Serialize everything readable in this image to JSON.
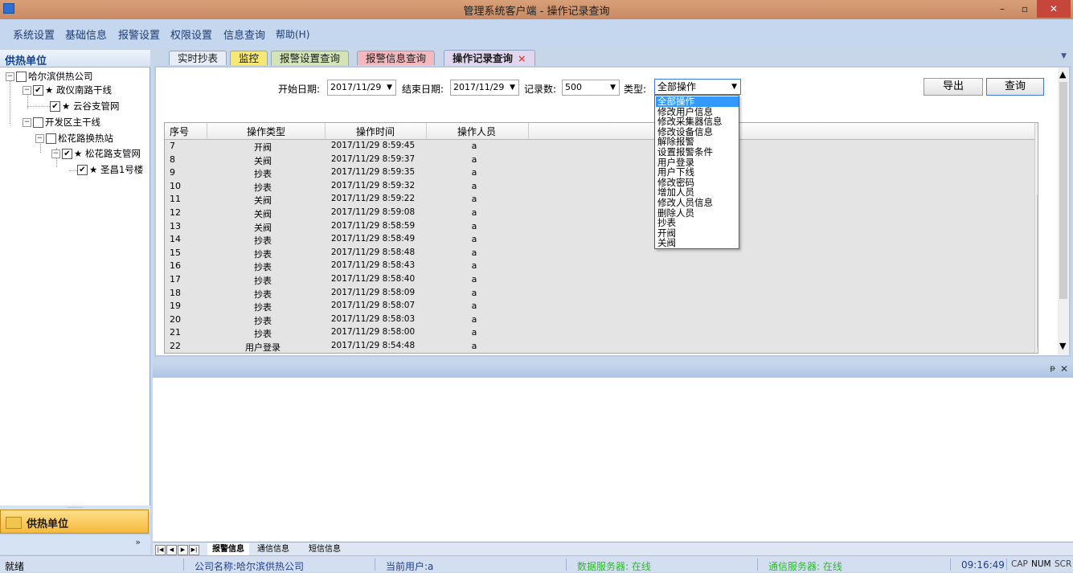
{
  "window": {
    "title": "管理系统客户端 - 操作记录查询",
    "min": "–",
    "max": "▫",
    "close": "✕"
  },
  "menu": [
    {
      "label": "系统设置"
    },
    {
      "label": "基础信息"
    },
    {
      "label": "报警设置"
    },
    {
      "label": "权限设置"
    },
    {
      "label": "信息查询"
    },
    {
      "label": "帮助(H)"
    }
  ],
  "left_panel": {
    "header": "供热单位",
    "tree": [
      {
        "label": "哈尔滨供热公司",
        "checked": false,
        "star": false
      },
      {
        "label": "政仪南路干线",
        "checked": true,
        "star": true
      },
      {
        "label": "云谷支管网",
        "checked": true,
        "star": true
      },
      {
        "label": "开发区主干线",
        "checked": false,
        "star": false
      },
      {
        "label": "松花路换热站",
        "checked": false,
        "star": false
      },
      {
        "label": "松花路支管网",
        "checked": true,
        "star": true
      },
      {
        "label": "圣昌1号楼",
        "checked": true,
        "star": true
      }
    ],
    "bottom_button": "供热单位",
    "chevron": "»",
    "grip": "··········"
  },
  "tabs": [
    {
      "label": "实时抄表",
      "color": "#e6edf7"
    },
    {
      "label": "监控",
      "color": "#f7e873"
    },
    {
      "label": "报警设置查询",
      "color": "#d4e4b8"
    },
    {
      "label": "报警信息查询",
      "color": "#f3b9bf"
    },
    {
      "label": "操作记录查询",
      "color": "#e0d6ee",
      "active": true
    }
  ],
  "tab_close": "×",
  "tab_scroll": "▼",
  "filters": {
    "start_label": "开始日期:",
    "start_value": "2017/11/29",
    "end_label": "结束日期:",
    "end_value": "2017/11/29",
    "count_label": "记录数:",
    "count_value": "500",
    "type_label": "类型:",
    "type_value": "全部操作"
  },
  "buttons": {
    "export": "导出",
    "query": "查询"
  },
  "grid": {
    "columns": [
      "序号",
      "操作类型",
      "操作时间",
      "操作人员"
    ],
    "rows": [
      [
        "7",
        "开阀",
        "2017/11/29 8:59:45",
        "a"
      ],
      [
        "8",
        "关阀",
        "2017/11/29 8:59:37",
        "a"
      ],
      [
        "9",
        "抄表",
        "2017/11/29 8:59:35",
        "a"
      ],
      [
        "10",
        "抄表",
        "2017/11/29 8:59:32",
        "a"
      ],
      [
        "11",
        "关阀",
        "2017/11/29 8:59:22",
        "a"
      ],
      [
        "12",
        "关阀",
        "2017/11/29 8:59:08",
        "a"
      ],
      [
        "13",
        "关阀",
        "2017/11/29 8:58:59",
        "a"
      ],
      [
        "14",
        "抄表",
        "2017/11/29 8:58:49",
        "a"
      ],
      [
        "15",
        "抄表",
        "2017/11/29 8:58:48",
        "a"
      ],
      [
        "16",
        "抄表",
        "2017/11/29 8:58:43",
        "a"
      ],
      [
        "17",
        "抄表",
        "2017/11/29 8:58:40",
        "a"
      ],
      [
        "18",
        "抄表",
        "2017/11/29 8:58:09",
        "a"
      ],
      [
        "19",
        "抄表",
        "2017/11/29 8:58:07",
        "a"
      ],
      [
        "20",
        "抄表",
        "2017/11/29 8:58:03",
        "a"
      ],
      [
        "21",
        "抄表",
        "2017/11/29 8:58:00",
        "a"
      ],
      [
        "22",
        "用户登录",
        "2017/11/29 8:54:48",
        "a"
      ]
    ]
  },
  "type_options": [
    "全部操作",
    "修改用户信息",
    "修改采集器信息",
    "修改设备信息",
    "解除报警",
    "设置报警条件",
    "用户登录",
    "用户下线",
    "修改密码",
    "增加人员",
    "修改人员信息",
    "删除人员",
    "抄表",
    "开阀",
    "关阀"
  ],
  "bottom_panel": {
    "pin": "ᵽ",
    "close": "✕",
    "nav": [
      "|◀",
      "◀",
      "▶",
      "▶|"
    ],
    "tabs": [
      "报警信息",
      "通信信息",
      "短信信息"
    ]
  },
  "status": {
    "ready": "就绪",
    "company": "公司名称:哈尔滨供热公司",
    "user": "当前用户:a",
    "data_server": "数据服务器: 在线",
    "comm_server": "通信服务器: 在线",
    "time": "09:16:49",
    "cap": "CAP",
    "num": "NUM",
    "scr": "SCR"
  },
  "colors": {
    "online": "#2fb82f",
    "status_blue": "#1f3f8f"
  }
}
